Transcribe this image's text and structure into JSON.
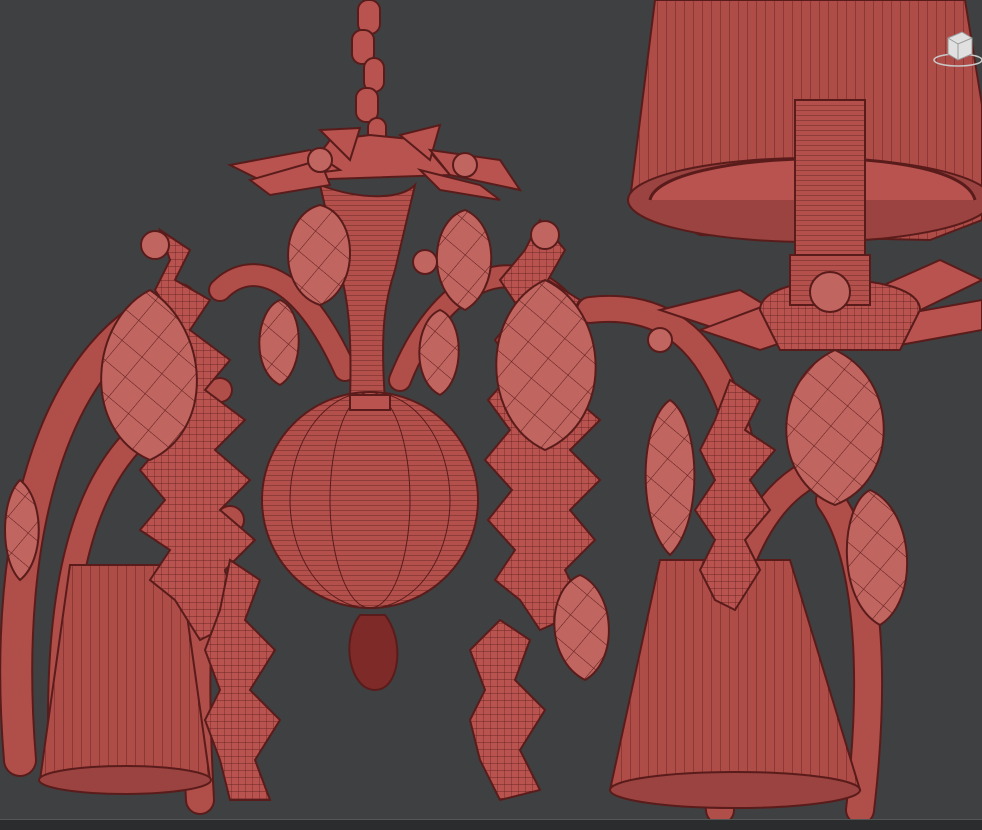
{
  "viewport": {
    "background": "#3f4042",
    "model_color": "#b8534f",
    "wire_color": "#5a1c1b"
  },
  "icons": {
    "viewcube": "viewcube-icon"
  }
}
